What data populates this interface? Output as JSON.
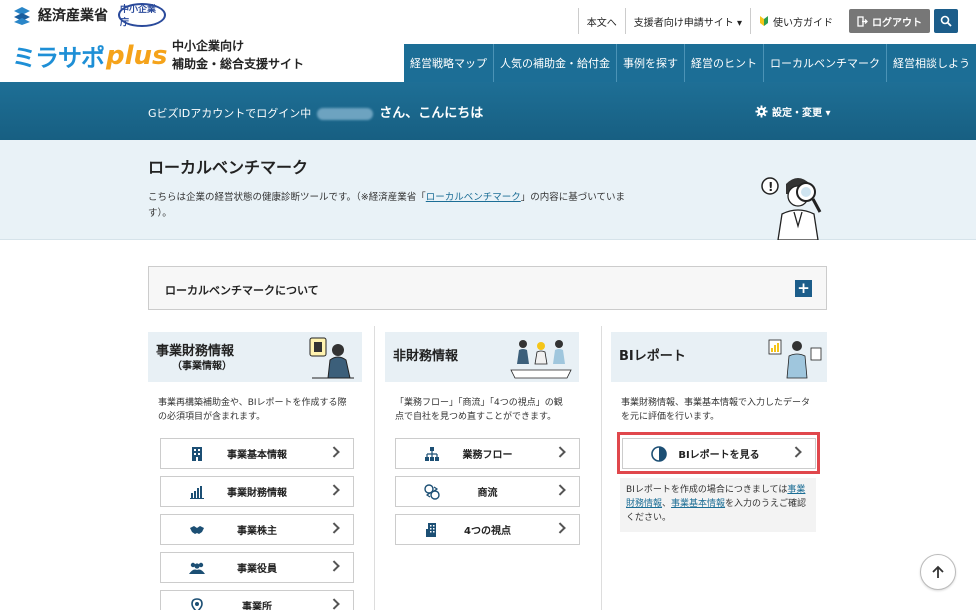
{
  "header": {
    "ministry": "経済産業省",
    "agency_badge": "中小企業庁",
    "logo_kana": "ミラサポ",
    "logo_plus": "plus",
    "logo_sub_1": "中小企業向け",
    "logo_sub_2": "補助金・総合支援サイト",
    "top_links": [
      "本文へ",
      "支援者向け申請サイト ▾",
      "使い方ガイド"
    ],
    "logout": "ログアウト",
    "nav": [
      "経営戦略マップ",
      "人気の補助金・給付金",
      "事例を探す",
      "経営のヒント",
      "ローカルベンチマーク",
      "経営相談しよう"
    ]
  },
  "login": {
    "prefix": "GビズIDアカウントでログイン中",
    "hello": "さん、こんにちは",
    "settings": "設定・変更 ▾"
  },
  "hero": {
    "title": "ローカルベンチマーク",
    "desc_before": "こちらは企業の経営状態の健康診断ツールです。（※経済産業省「",
    "desc_link": "ローカルベンチマーク",
    "desc_after": "」の内容に基づいています）。"
  },
  "accordion": {
    "label": "ローカルベンチマークについて"
  },
  "columns": {
    "finance": {
      "title": "事業財務情報",
      "subtitle": "（事業情報）",
      "desc": "事業再構築補助金や、BIレポートを作成する際の必須項目が含まれます。",
      "buttons": [
        "事業基本情報",
        "事業財務情報",
        "事業株主",
        "事業役員",
        "事業所"
      ]
    },
    "nonfinance": {
      "title": "非財務情報",
      "desc": "「業務フロー」「商流」「4つの視点」の観点で自社を見つめ直すことができます。",
      "buttons": [
        "業務フロー",
        "商流",
        "4つの視点"
      ]
    },
    "bi": {
      "title": "BIレポート",
      "desc": "事業財務情報、事業基本情報で入力したデータを元に評価を行います。",
      "button": "BIレポートを見る",
      "note_before": "BIレポートを作成の場合につきましては",
      "note_link1": "事業財務情報",
      "note_mid": "、",
      "note_link2": "事業基本情報",
      "note_after": "を入力のうえご確認ください。"
    }
  },
  "colors": {
    "nav_bg": "#1c6e96",
    "accent_orange": "#f5a31a",
    "highlight_red": "#e0474c"
  }
}
